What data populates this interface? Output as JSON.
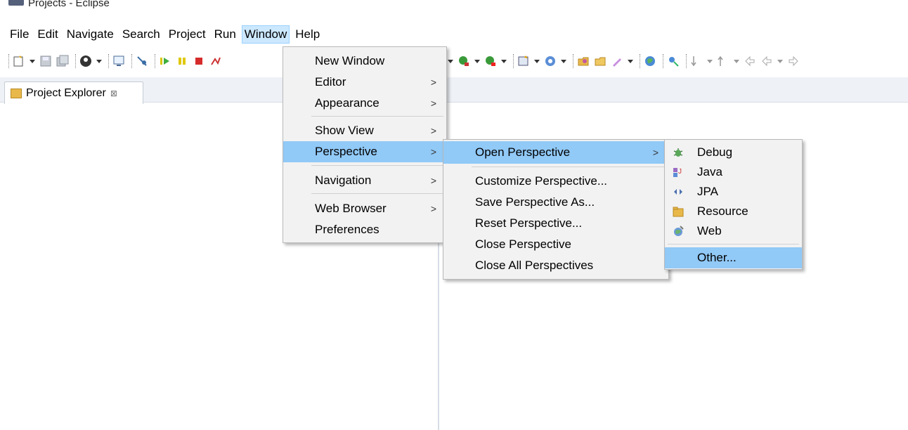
{
  "window": {
    "title": "Projects - Eclipse"
  },
  "menubar": {
    "items": [
      {
        "label": "File"
      },
      {
        "label": "Edit"
      },
      {
        "label": "Navigate"
      },
      {
        "label": "Search"
      },
      {
        "label": "Project"
      },
      {
        "label": "Run"
      },
      {
        "label": "Window"
      },
      {
        "label": "Help"
      }
    ]
  },
  "explorer": {
    "tab_label": "Project Explorer",
    "close_glyph": "⊠"
  },
  "window_menu": {
    "items": [
      {
        "label": "New Window"
      },
      {
        "label": "Editor"
      },
      {
        "label": "Appearance"
      },
      {
        "label": "Show View"
      },
      {
        "label": "Perspective"
      },
      {
        "label": "Navigation"
      },
      {
        "label": "Web Browser"
      },
      {
        "label": "Preferences"
      }
    ]
  },
  "perspective_menu": {
    "items": [
      {
        "label": "Open Perspective"
      },
      {
        "label": "Customize Perspective..."
      },
      {
        "label": "Save Perspective As..."
      },
      {
        "label": "Reset Perspective..."
      },
      {
        "label": "Close Perspective"
      },
      {
        "label": "Close All Perspectives"
      }
    ]
  },
  "open_perspective_menu": {
    "items": [
      {
        "label": "Debug",
        "icon": "debug-icon"
      },
      {
        "label": "Java",
        "icon": "java-icon"
      },
      {
        "label": "JPA",
        "icon": "jpa-icon"
      },
      {
        "label": "Resource",
        "icon": "resource-icon"
      },
      {
        "label": "Web",
        "icon": "web-icon"
      },
      {
        "label": "Other..."
      }
    ]
  },
  "colors": {
    "highlight": "#91c9f7",
    "menu_bg": "#f2f2f2",
    "active_menubar": "#cce8ff"
  }
}
